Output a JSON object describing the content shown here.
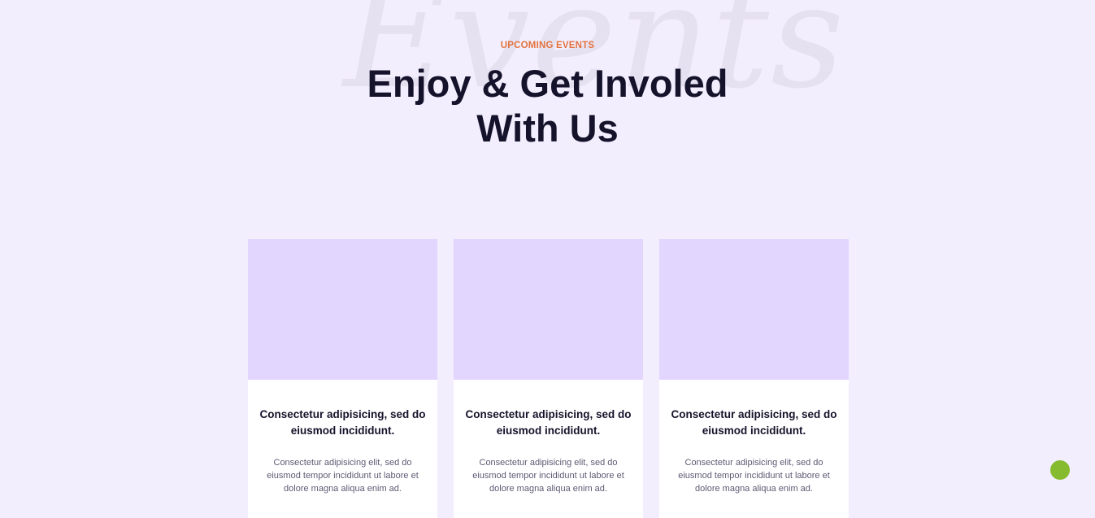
{
  "background_word": "Events",
  "header": {
    "eyebrow": "UPCOMING EVENTS",
    "title_line1": "Enjoy & Get Involed",
    "title_line2": "With Us"
  },
  "cards": [
    {
      "title": "Consectetur adipisicing, sed do eiusmod incididunt.",
      "text": "Consectetur adipisicing elit, sed do eiusmod tempor incididunt ut labore et dolore magna aliqua enim ad."
    },
    {
      "title": "Consectetur adipisicing, sed do eiusmod incididunt.",
      "text": "Consectetur adipisicing elit, sed do eiusmod tempor incididunt ut labore et dolore magna aliqua enim ad."
    },
    {
      "title": "Consectetur adipisicing, sed do eiusmod incididunt.",
      "text": "Consectetur adipisicing elit, sed do eiusmod tempor incididunt ut labore et dolore magna aliqua enim ad."
    }
  ],
  "colors": {
    "page_background": "#f3eefe",
    "accent_orange": "#e3733f",
    "heading": "#15132b",
    "card_image_placeholder": "#e2d6ff",
    "floating_button": "#86bb2f"
  }
}
